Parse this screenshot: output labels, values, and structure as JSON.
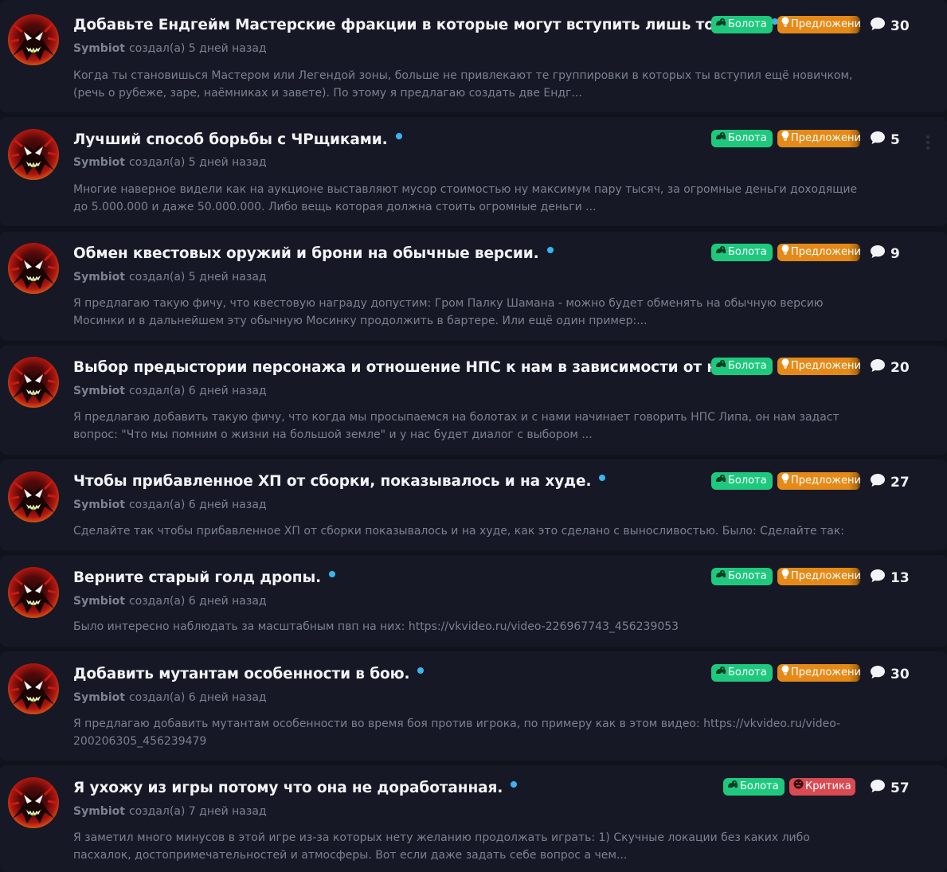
{
  "topics": [
    {
      "title": "Добавьте Ендгейм Мастерские фракции в которые могут вступить лишь топеры.",
      "author": "Symbiot",
      "created": "создал(а) 5 дней назад",
      "excerpt": "Когда ты становишься Мастером или Легендой зоны, больше не привлекают те группировки в которых ты вступил ещё новичком, (речь о рубеже, заре, наёмниках и завете). По этому я предлагаю создать две Ендг...",
      "tags": [
        {
          "label": "Болота",
          "kind": "swamp"
        },
        {
          "label": "Предложения",
          "kind": "suggest"
        }
      ],
      "comments": "30"
    },
    {
      "title": "Лучший способ борьбы с ЧРщиками.",
      "author": "Symbiot",
      "created": "создал(а) 5 дней назад",
      "excerpt": "Многие наверное видели как на аукционе выставляют мусор стоимостью ну максимум пару тысяч, за огромные деньги доходящие до 5.000.000 и даже 50.000.000. Либо вещь которая должна стоить огромные деньги ...",
      "tags": [
        {
          "label": "Болота",
          "kind": "swamp"
        },
        {
          "label": "Предложения",
          "kind": "suggest"
        }
      ],
      "comments": "5"
    },
    {
      "title": "Обмен квестовых оружий и брони на обычные версии.",
      "author": "Symbiot",
      "created": "создал(а) 5 дней назад",
      "excerpt": "Я предлагаю такую фичу, что квестовую награду допустим: Гром Палку Шамана - можно будет обменять на обычную версию Мосинки и в дальнейшем эту обычную Мосинку продолжить в бартере. Или ещё один пример:...",
      "tags": [
        {
          "label": "Болота",
          "kind": "swamp"
        },
        {
          "label": "Предложения",
          "kind": "suggest"
        }
      ],
      "comments": "9"
    },
    {
      "title": "Выбор предыстории персонажа и отношение НПС к нам в зависимости от неё.",
      "author": "Symbiot",
      "created": "создал(а) 6 дней назад",
      "excerpt": "Я предлагаю добавить такую фичу, что когда мы просыпаемся на болотах и с нами начинает говорить НПС Липа, он нам задаст вопрос: \"Что мы помним о жизни на большой земле\" и у нас будет диалог с выбором ...",
      "tags": [
        {
          "label": "Болота",
          "kind": "swamp"
        },
        {
          "label": "Предложения",
          "kind": "suggest"
        }
      ],
      "comments": "20"
    },
    {
      "title": "Чтобы прибавленное ХП от сборки, показывалось и на худе.",
      "author": "Symbiot",
      "created": "создал(а) 6 дней назад",
      "excerpt": "Сделайте так чтобы прибавленное ХП от сборки показывалось и на худе, как это сделано с выносливостью. Было: Сделайте так:",
      "tags": [
        {
          "label": "Болота",
          "kind": "swamp"
        },
        {
          "label": "Предложения",
          "kind": "suggest"
        }
      ],
      "comments": "27"
    },
    {
      "title": "Верните старый голд дропы.",
      "author": "Symbiot",
      "created": "создал(а) 6 дней назад",
      "excerpt": "Было интересно наблюдать за масштабным пвп на них: https://vkvideo.ru/video-226967743_456239053",
      "tags": [
        {
          "label": "Болота",
          "kind": "swamp"
        },
        {
          "label": "Предложения",
          "kind": "suggest"
        }
      ],
      "comments": "13"
    },
    {
      "title": "Добавить мутантам особенности в бою.",
      "author": "Symbiot",
      "created": "создал(а) 6 дней назад",
      "excerpt": "Я предлагаю добавить мутантам особенности во время боя против игрока, по примеру как в этом видео: https://vkvideo.ru/video-200206305_456239479",
      "tags": [
        {
          "label": "Болота",
          "kind": "swamp"
        },
        {
          "label": "Предложения",
          "kind": "suggest"
        }
      ],
      "comments": "30"
    },
    {
      "title": "Я ухожу из игры потому что она не доработанная.",
      "author": "Symbiot",
      "created": "создал(а) 7 дней назад",
      "excerpt": "Я заметил много минусов в этой игре из-за которых нету желанию продолжать играть: 1) Скучные локации без каких либо пасхалок, достопримечательностей и атмосферы. Вот если даже задать себе вопрос а чем...",
      "tags": [
        {
          "label": "Болота",
          "kind": "swamp"
        },
        {
          "label": "Критика",
          "kind": "crit"
        }
      ],
      "comments": "57"
    }
  ],
  "icons": {
    "swamp": "frog-icon",
    "suggest": "lightbulb-icon",
    "crit": "angry-face-icon",
    "comments": "comment-bubble-icon",
    "menu": "kebab-menu-icon"
  },
  "colors": {
    "background": "#11131c",
    "card": "#161925",
    "unread_dot": "#38b6f2",
    "tag_swamp": "#1ec97e",
    "tag_suggest": "#e58a18",
    "tag_crit": "#d94a52"
  }
}
